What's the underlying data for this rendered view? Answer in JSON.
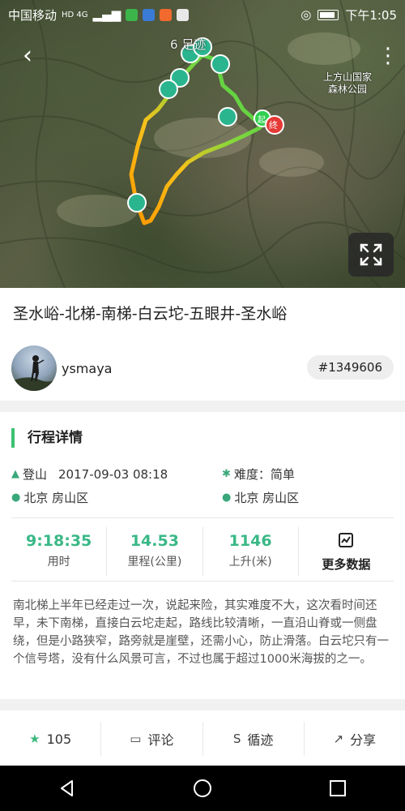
{
  "status_bar": {
    "carrier": "中国移动",
    "network": "HD 4G",
    "time": "下午1:05"
  },
  "map": {
    "park_label_line1": "上方山国家",
    "park_label_line2": "森林公园",
    "logo_text": "6 足迹",
    "end_marker": "终",
    "start_marker": "起"
  },
  "route": {
    "title": "圣水峪-北梯-南梯-白云坨-五眼井-圣水峪",
    "author": "ysmaya",
    "id": "#1349606"
  },
  "details": {
    "section_title": "行程详情",
    "activity": "登山",
    "datetime": "2017-09-03  08:18",
    "difficulty": "难度：简单",
    "start_location": "北京  房山区",
    "end_location": "北京  房山区"
  },
  "stats": [
    {
      "value": "9:18:35",
      "label": "用时"
    },
    {
      "value": "14.53",
      "label": "里程(公里)"
    },
    {
      "value": "1146",
      "label": "上升(米)"
    }
  ],
  "more_data_label": "更多数据",
  "description": "南北梯上半年已经走过一次，说起来险，其实难度不大，这次看时间还早，未下南梯，直接白云坨走起，路线比较清晰，一直沿山脊或一侧盘绕，但是小路狭窄，路旁就是崖壁，还需小心，防止滑落。白云坨只有一个信号塔，没有什么风景可言，不过也属于超过1000米海拔的之一。",
  "actions": {
    "likes": "105",
    "comment": "评论",
    "follow_track": "循迹",
    "share": "分享"
  },
  "colors": {
    "accent": "#3cc173",
    "stat_value": "#39b886"
  }
}
